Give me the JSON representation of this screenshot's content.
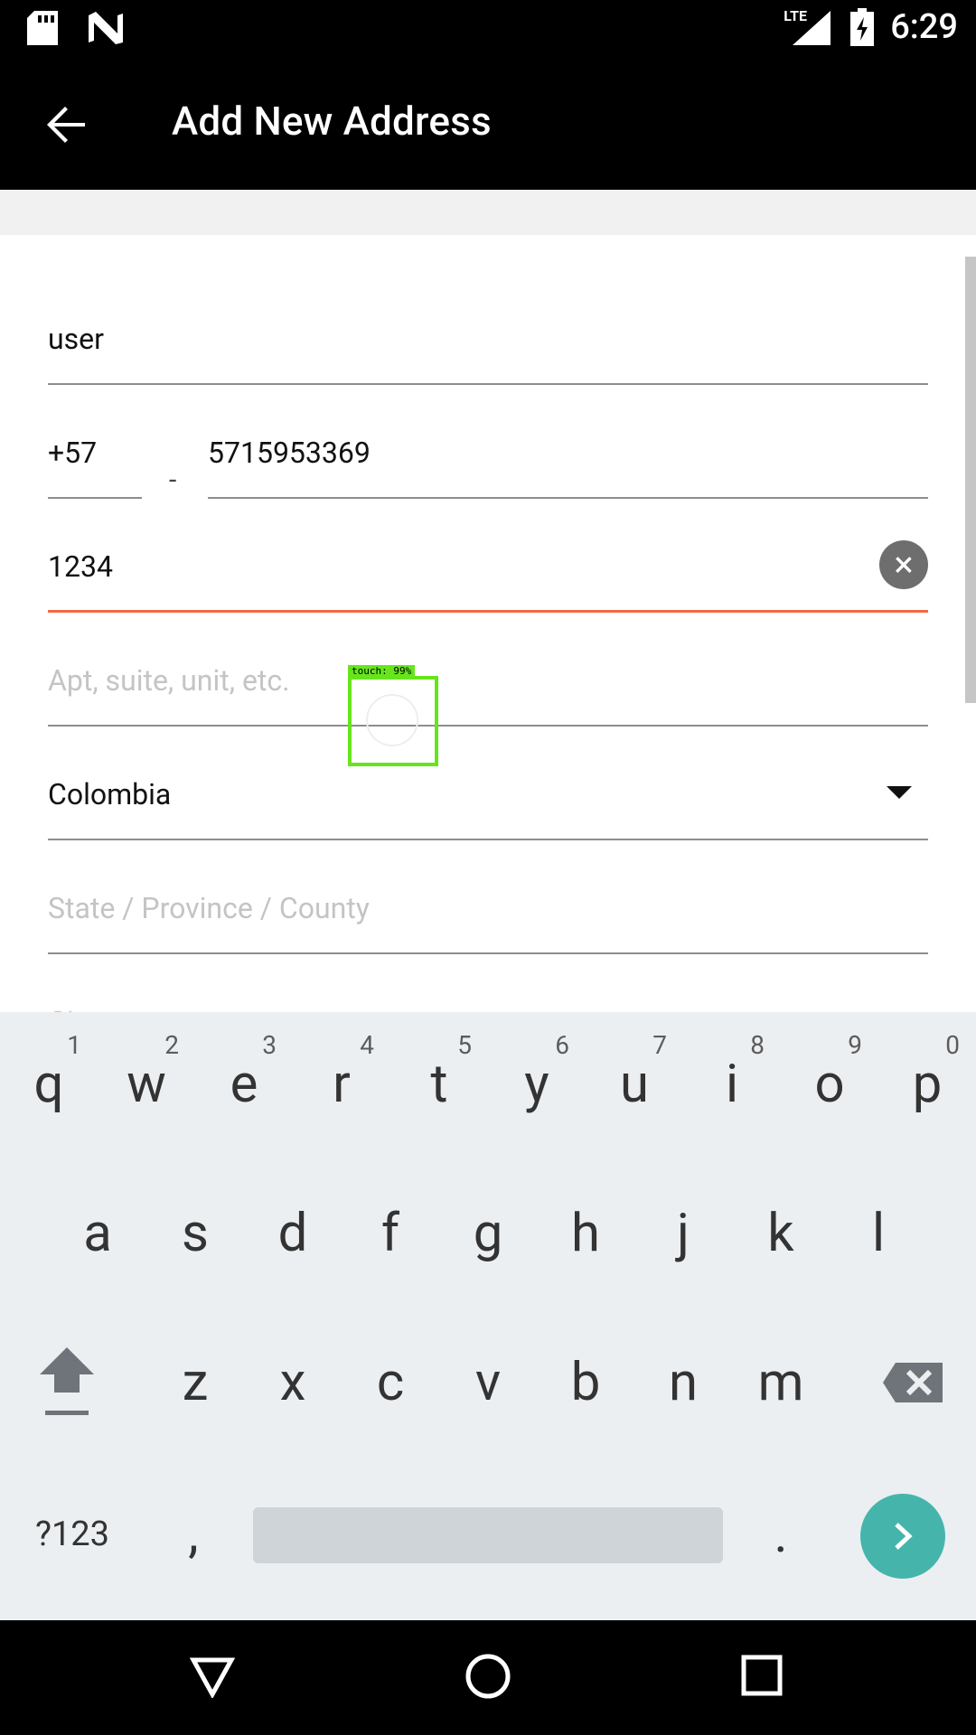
{
  "status_bar": {
    "time": "6:29",
    "network": "LTE",
    "icons": [
      "sd-card-icon",
      "n-logo-icon",
      "signal-icon",
      "battery-charging-icon"
    ]
  },
  "app_bar": {
    "title": "Add New Address",
    "back_icon": "arrow-left-icon"
  },
  "form": {
    "name_value": "user",
    "phone_code": "+57",
    "phone_separator": "-",
    "phone_number": "5715953369",
    "street_value": "1234",
    "apt_placeholder": "Apt, suite, unit, etc.",
    "country_value": "Colombia",
    "state_placeholder": "State / Province / County",
    "city_placeholder": "City"
  },
  "touch_overlay": {
    "label": "touch: 99%"
  },
  "keyboard": {
    "row1": [
      {
        "k": "q",
        "h": "1"
      },
      {
        "k": "w",
        "h": "2"
      },
      {
        "k": "e",
        "h": "3"
      },
      {
        "k": "r",
        "h": "4"
      },
      {
        "k": "t",
        "h": "5"
      },
      {
        "k": "y",
        "h": "6"
      },
      {
        "k": "u",
        "h": "7"
      },
      {
        "k": "i",
        "h": "8"
      },
      {
        "k": "o",
        "h": "9"
      },
      {
        "k": "p",
        "h": "0"
      }
    ],
    "row2": [
      "a",
      "s",
      "d",
      "f",
      "g",
      "h",
      "j",
      "k",
      "l"
    ],
    "row3": [
      "z",
      "x",
      "c",
      "v",
      "b",
      "n",
      "m"
    ],
    "symbols_label": "?123",
    "comma": ",",
    "period": ".",
    "accent_color": "#45b5ac"
  },
  "colors": {
    "active_underline": "#ee6a45",
    "touch_box": "#66e51c"
  }
}
